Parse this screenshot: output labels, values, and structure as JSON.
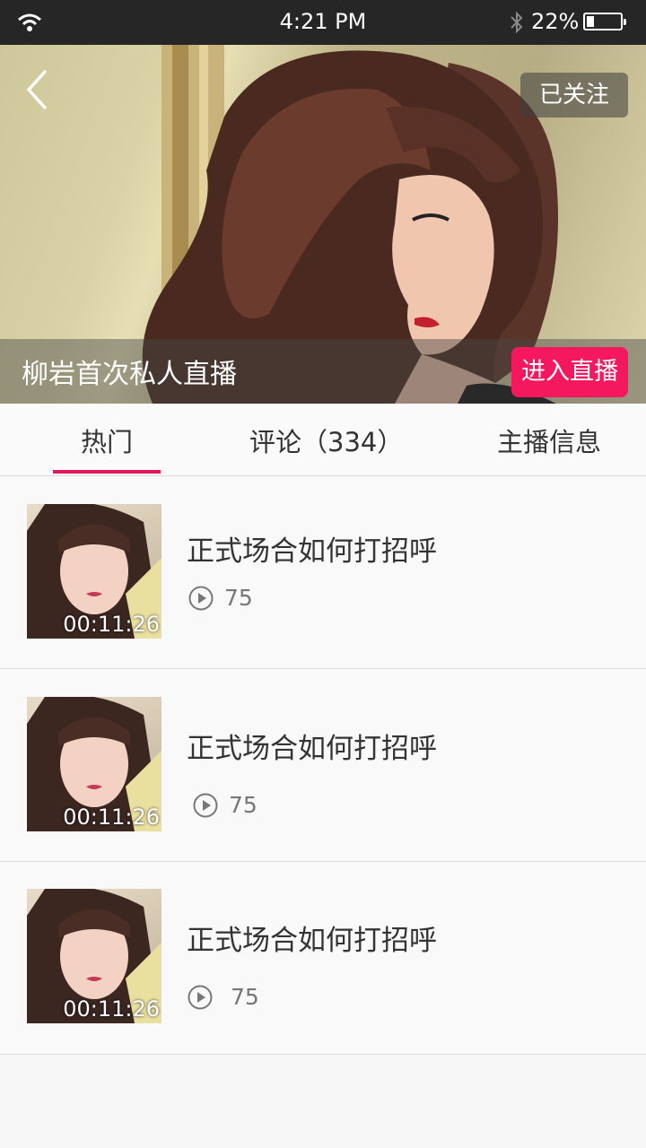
{
  "status_bar": {
    "time": "4:21 PM",
    "battery_percent": "22%",
    "battery_level": 0.22
  },
  "hero": {
    "follow_label": "已关注",
    "title": "柳岩首次私人直播",
    "enter_live_label": "进入直播"
  },
  "tabs": [
    {
      "label": "热门",
      "active": true
    },
    {
      "label": "评论（334）",
      "active": false
    },
    {
      "label": "主播信息",
      "active": false
    }
  ],
  "videos": [
    {
      "title": "正式场合如何打招呼",
      "duration": "00:11:26",
      "plays": "75"
    },
    {
      "title": "正式场合如何打招呼",
      "duration": "00:11:26",
      "plays": "75"
    },
    {
      "title": "正式场合如何打招呼",
      "duration": "00:11:26",
      "plays": "75"
    }
  ],
  "colors": {
    "accent": "#f5185f",
    "tab_indicator": "#e2185b",
    "status_bar": "#262626"
  },
  "icons": [
    "wifi-icon",
    "bluetooth-icon",
    "battery-icon",
    "back-arrow-icon",
    "play-icon"
  ]
}
